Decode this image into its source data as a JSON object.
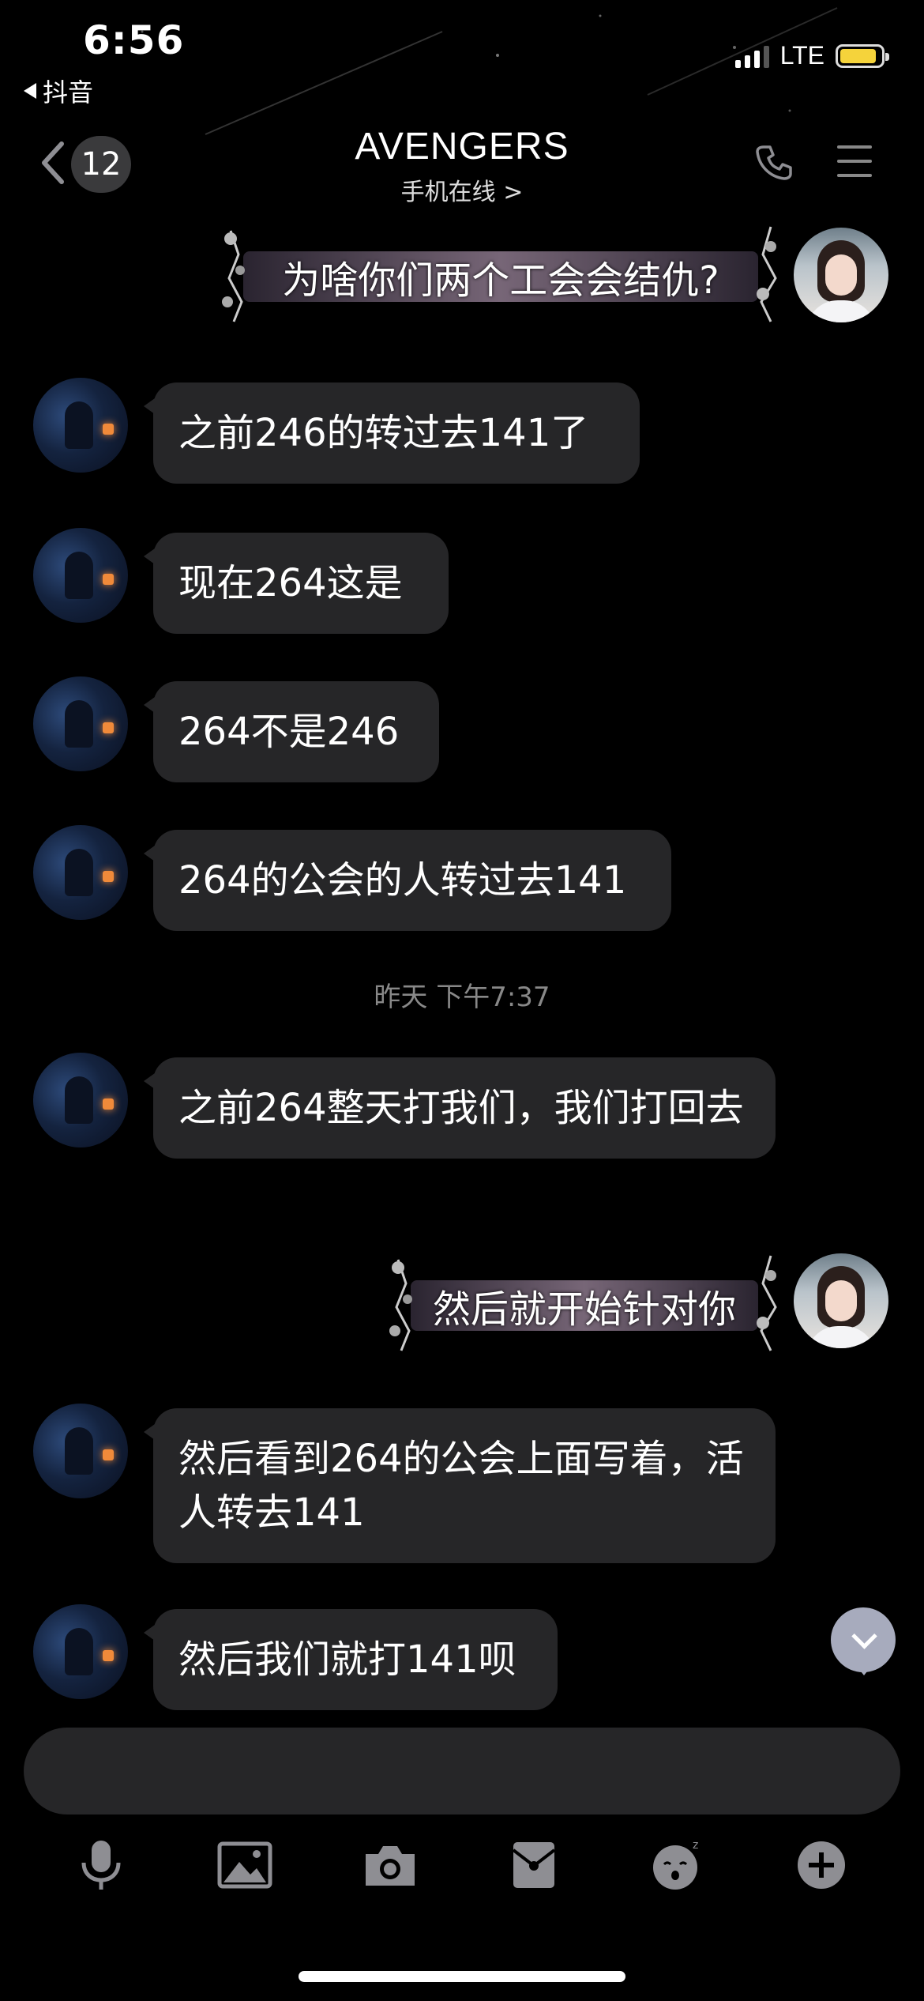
{
  "status_bar": {
    "time": "6:56",
    "back_app": "抖音",
    "network": "LTE"
  },
  "header": {
    "unread_count": "12",
    "title": "AVENGERS",
    "subtitle": "手机在线 >"
  },
  "messages": [
    {
      "sender": "me",
      "text": "为啥你们两个工会会结仇?"
    },
    {
      "sender": "other",
      "text": "之前246的转过去141了"
    },
    {
      "sender": "other",
      "text": "现在264这是"
    },
    {
      "sender": "other",
      "text": "264不是246"
    },
    {
      "sender": "other",
      "text": "264的公会的人转过去141"
    },
    {
      "type": "timestamp",
      "text": "昨天 下午7:37"
    },
    {
      "sender": "other",
      "text": "之前264整天打我们，我们打回去"
    },
    {
      "sender": "me",
      "text": "然后就开始针对你"
    },
    {
      "sender": "other",
      "text": "然后看到264的公会上面写着，活人转去141"
    },
    {
      "sender": "other",
      "text": "然后我们就打141呗"
    }
  ],
  "composer": {
    "value": "",
    "placeholder": ""
  },
  "toolbar": {
    "items": [
      "mic-icon",
      "image-icon",
      "camera-icon",
      "red-packet-icon",
      "emoji-icon",
      "plus-icon"
    ]
  },
  "colors": {
    "background": "#000000",
    "bubble": "#262628",
    "battery": "#f5d33b",
    "scroll_button": "#a7abbd",
    "toolbar_icon": "#8e8e93"
  }
}
